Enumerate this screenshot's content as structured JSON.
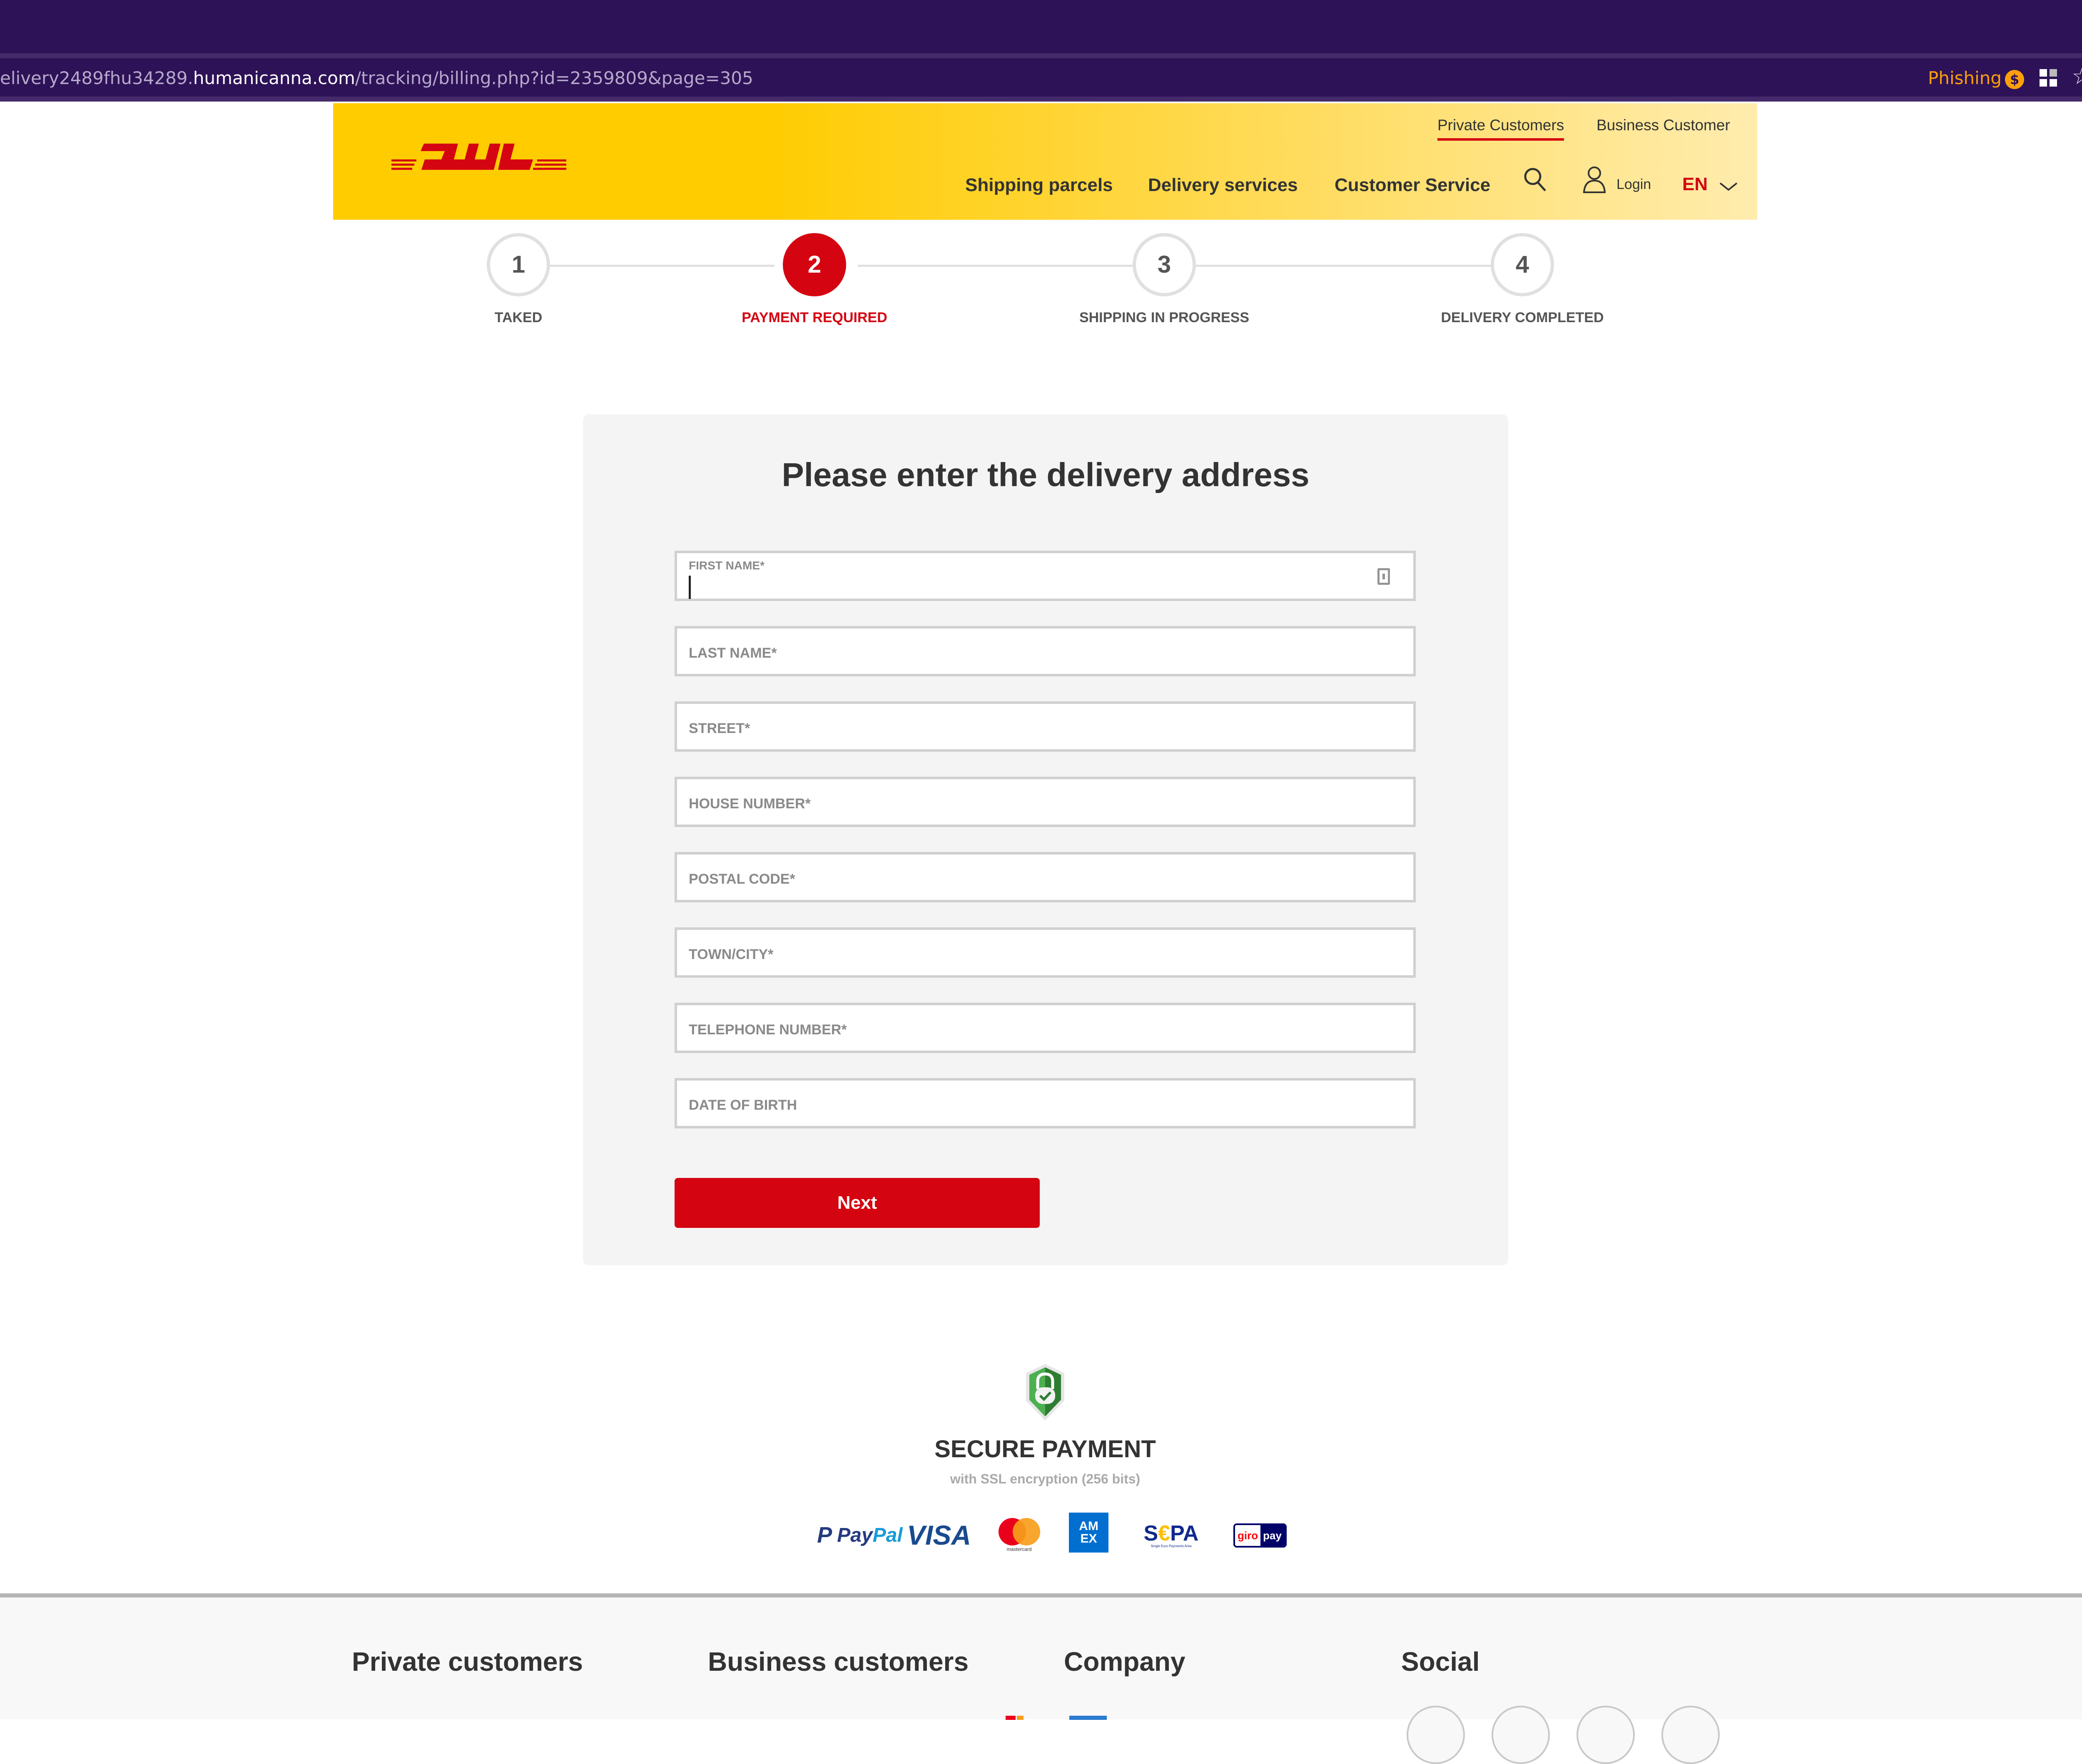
{
  "browser": {
    "url_prefix": "elivery2489fhu34289.",
    "url_host": "humanicanna.com",
    "url_path": "/tracking/billing.php?id=2359809&page=305",
    "phishing_badge": "Phishing",
    "phishing_coin_glyph": "$",
    "icons": [
      "qr-grid-icon",
      "bookmark-star-icon"
    ],
    "star_glyph": "☆"
  },
  "header": {
    "logo_alt": "DHL",
    "top_links": [
      {
        "label": "Private Customers",
        "active": true
      },
      {
        "label": "Business Customer",
        "active": false
      }
    ],
    "nav": [
      {
        "label": "Shipping parcels"
      },
      {
        "label": "Delivery services"
      },
      {
        "label": "Customer Service"
      }
    ],
    "login_label": "Login",
    "language": "EN",
    "colors": {
      "brand_yellow": "#ffcc00",
      "brand_red": "#d40511"
    }
  },
  "stepper": {
    "current_step": 2,
    "steps": [
      {
        "number": "1",
        "label": "TAKED"
      },
      {
        "number": "2",
        "label": "PAYMENT REQUIRED"
      },
      {
        "number": "3",
        "label": "SHIPPING IN PROGRESS"
      },
      {
        "number": "4",
        "label": "DELIVERY COMPLETED"
      }
    ]
  },
  "form": {
    "title": "Please enter the delivery address",
    "fields": [
      {
        "label": "FIRST NAME*",
        "value": "",
        "focused": true
      },
      {
        "label": "LAST NAME*",
        "value": ""
      },
      {
        "label": "STREET*",
        "value": ""
      },
      {
        "label": "HOUSE NUMBER*",
        "value": ""
      },
      {
        "label": "POSTAL CODE*",
        "value": ""
      },
      {
        "label": "TOWN/CITY*",
        "value": ""
      },
      {
        "label": "TELEPHONE NUMBER*",
        "value": ""
      },
      {
        "label": "DATE OF BIRTH",
        "value": ""
      }
    ],
    "submit_label": "Next"
  },
  "secure": {
    "title": "SECURE PAYMENT",
    "subtitle": "with SSL encryption (256 bits)",
    "payment_methods": {
      "paypal_a": "Pay",
      "paypal_b": "Pal",
      "visa": "VISA",
      "mastercard": "mastercard",
      "amex_1": "AM",
      "amex_2": "EX",
      "sepa_s": "S",
      "sepa_euro": "€",
      "sepa_pa": "PA",
      "sepa_sub": "Single Euro Payments Area",
      "giropay_giro": "giro",
      "giropay_pay": "pay"
    }
  },
  "footer": {
    "columns": [
      {
        "heading": "Private customers"
      },
      {
        "heading": "Business customers"
      },
      {
        "heading": "Company"
      },
      {
        "heading": "Social"
      }
    ]
  }
}
